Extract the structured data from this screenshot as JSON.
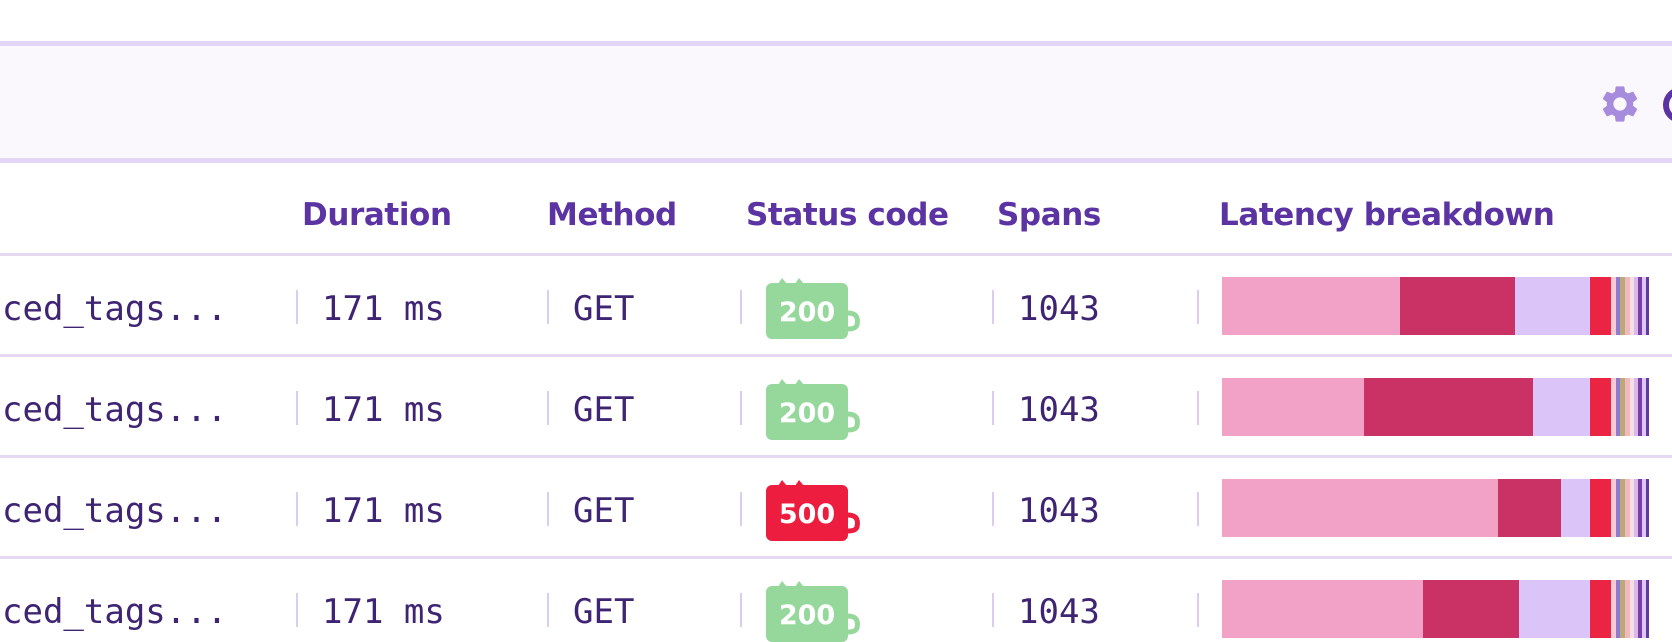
{
  "toolbar": {
    "settings_icon": "gear-icon",
    "edge_icon": "circle-icon"
  },
  "table": {
    "columns": [
      "Duration",
      "Method",
      "Status code",
      "Spans",
      "Latency breakdown"
    ],
    "rows": [
      {
        "name": "ced_tags...",
        "duration": "171 ms",
        "method": "GET",
        "status": "200",
        "status_color": "#96d89c",
        "spans": "1043",
        "latency": [
          {
            "fraction": 0.413,
            "color": "#f2a1c7"
          },
          {
            "fraction": 0.265,
            "color": "#ca3265"
          },
          {
            "fraction": 0.175,
            "color": "#dac4f8"
          },
          {
            "fraction": 0.047,
            "color": "#ec2443"
          },
          {
            "fraction": 0.012,
            "color": "#f7ccd7"
          },
          {
            "fraction": 0.01,
            "color": "#8f7ad0"
          },
          {
            "fraction": 0.01,
            "color": "#b9aa7a"
          },
          {
            "fraction": 0.012,
            "color": "#f3b7be"
          },
          {
            "fraction": 0.01,
            "color": "#f5dfe6"
          },
          {
            "fraction": 0.01,
            "color": "#d9b9ea"
          },
          {
            "fraction": 0.008,
            "color": "#7a3ea9"
          },
          {
            "fraction": 0.01,
            "color": "#dcc7f5"
          },
          {
            "fraction": 0.006,
            "color": "#5f3aa3"
          }
        ]
      },
      {
        "name": "ced_tags...",
        "duration": "171 ms",
        "method": "GET",
        "status": "200",
        "status_color": "#96d89c",
        "spans": "1043",
        "latency": [
          {
            "fraction": 0.329,
            "color": "#f2a1c7"
          },
          {
            "fraction": 0.391,
            "color": "#ca3265"
          },
          {
            "fraction": 0.133,
            "color": "#dac4f8"
          },
          {
            "fraction": 0.047,
            "color": "#ec2443"
          },
          {
            "fraction": 0.012,
            "color": "#f7ccd7"
          },
          {
            "fraction": 0.01,
            "color": "#8f7ad0"
          },
          {
            "fraction": 0.01,
            "color": "#b9aa7a"
          },
          {
            "fraction": 0.012,
            "color": "#f3b7be"
          },
          {
            "fraction": 0.01,
            "color": "#f5dfe6"
          },
          {
            "fraction": 0.01,
            "color": "#d9b9ea"
          },
          {
            "fraction": 0.008,
            "color": "#7a3ea9"
          },
          {
            "fraction": 0.01,
            "color": "#dcc7f5"
          },
          {
            "fraction": 0.006,
            "color": "#5f3aa3"
          }
        ]
      },
      {
        "name": "ced_tags...",
        "duration": "171 ms",
        "method": "GET",
        "status": "500",
        "status_color": "#ec1d3f",
        "spans": "1043",
        "latency": [
          {
            "fraction": 0.638,
            "color": "#f2a1c7"
          },
          {
            "fraction": 0.146,
            "color": "#ca3265"
          },
          {
            "fraction": 0.069,
            "color": "#dac4f8"
          },
          {
            "fraction": 0.047,
            "color": "#ec2443"
          },
          {
            "fraction": 0.012,
            "color": "#f7ccd7"
          },
          {
            "fraction": 0.01,
            "color": "#8f7ad0"
          },
          {
            "fraction": 0.01,
            "color": "#b9aa7a"
          },
          {
            "fraction": 0.012,
            "color": "#f3b7be"
          },
          {
            "fraction": 0.01,
            "color": "#f5dfe6"
          },
          {
            "fraction": 0.01,
            "color": "#d9b9ea"
          },
          {
            "fraction": 0.008,
            "color": "#7a3ea9"
          },
          {
            "fraction": 0.01,
            "color": "#dcc7f5"
          },
          {
            "fraction": 0.006,
            "color": "#5f3aa3"
          }
        ]
      },
      {
        "name": "ced_tags...",
        "duration": "171 ms",
        "method": "GET",
        "status": "200",
        "status_color": "#96d89c",
        "spans": "1043",
        "latency": [
          {
            "fraction": 0.465,
            "color": "#f2a1c7"
          },
          {
            "fraction": 0.223,
            "color": "#ca3265"
          },
          {
            "fraction": 0.165,
            "color": "#dac4f8"
          },
          {
            "fraction": 0.047,
            "color": "#ec2443"
          },
          {
            "fraction": 0.012,
            "color": "#f7ccd7"
          },
          {
            "fraction": 0.01,
            "color": "#8f7ad0"
          },
          {
            "fraction": 0.01,
            "color": "#b9aa7a"
          },
          {
            "fraction": 0.012,
            "color": "#f3b7be"
          },
          {
            "fraction": 0.01,
            "color": "#f5dfe6"
          },
          {
            "fraction": 0.01,
            "color": "#d9b9ea"
          },
          {
            "fraction": 0.008,
            "color": "#7a3ea9"
          },
          {
            "fraction": 0.01,
            "color": "#dcc7f5"
          },
          {
            "fraction": 0.006,
            "color": "#5f3aa3"
          }
        ]
      }
    ]
  },
  "colors": {
    "accent": "#5b33a3",
    "icon": "#a78bdc",
    "border": "#e4d8f3",
    "toolbar_bg": "#faf8fc"
  }
}
